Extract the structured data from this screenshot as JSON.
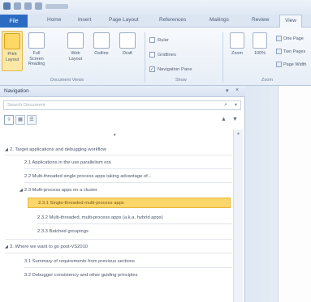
{
  "ribbon": {
    "file_tab": "File",
    "tabs": [
      "Home",
      "Insert",
      "Page Layout",
      "References",
      "Mailings",
      "Review",
      "View"
    ],
    "active_tab": "View",
    "buttons": [
      {
        "label": "Print Layout",
        "selected": true
      },
      {
        "label": "Full Screen Reading",
        "selected": false
      },
      {
        "label": "Web Layout",
        "selected": false
      },
      {
        "label": "Outline",
        "selected": false
      },
      {
        "label": "Draft",
        "selected": false
      }
    ],
    "group_document_views": "Document Views",
    "show": {
      "ruler": "Ruler",
      "gridlines": "Gridlines",
      "navigation_pane": "Navigation Pane",
      "group_label": "Show"
    },
    "zoom": {
      "zoom_label": "Zoom",
      "percent_label": "100%",
      "one_page": "One Page",
      "two_pages": "Two Pages",
      "page_width": "Page Width",
      "group_label": "Zoom"
    }
  },
  "navigation": {
    "title": "Navigation",
    "search_placeholder": "Search Document",
    "items": [
      {
        "text": "2. Target applications and debugging workflow",
        "level": 0,
        "highlighted": false
      },
      {
        "text": "2.1 Applications in the use parallelism era",
        "level": 1,
        "highlighted": false
      },
      {
        "text": "2.2 Multi-threaded single process apps taking advantage of...",
        "level": 1,
        "highlighted": false
      },
      {
        "text": "2.3 Multi-process apps on a cluster",
        "level": 1,
        "highlighted": false
      },
      {
        "text": "2.3.1 Single-threaded multi-process apps",
        "level": 2,
        "highlighted": true
      },
      {
        "text": "2.3.2 Multi-threaded, multi-process apps (a.k.a. hybrid apps)",
        "level": 2,
        "highlighted": false
      },
      {
        "text": "2.3.3 Batched groupings",
        "level": 2,
        "highlighted": false
      },
      {
        "text": "3. Where we want to go post-VS2010",
        "level": 0,
        "highlighted": false
      },
      {
        "text": "3.1 Summary of requirements from previous sections",
        "level": 1,
        "highlighted": false
      },
      {
        "text": "3.2 Debugger consistency and other guiding principles",
        "level": 1,
        "highlighted": false
      }
    ]
  }
}
